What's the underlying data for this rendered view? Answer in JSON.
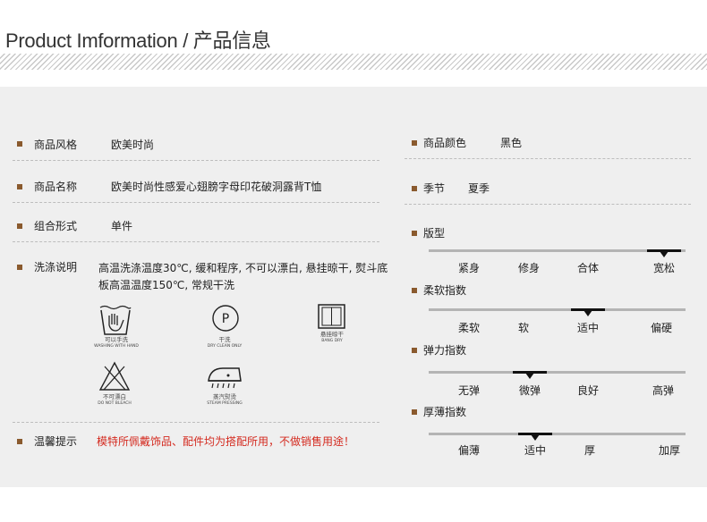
{
  "page": {
    "title": "Product Imformation / 产品信息"
  },
  "left": {
    "style": {
      "label": "商品风格",
      "value": "欧美时尚"
    },
    "name": {
      "label": "商品名称",
      "value": "欧美时尚性感爱心翅膀字母印花破洞露背T恤"
    },
    "combo": {
      "label": "组合形式",
      "value": "单件"
    },
    "washing": {
      "label": "洗涤说明",
      "text": "高温洗涤温度30℃, 缓和程序, 不可以漂白, 悬挂晾干, 熨斗底板高温温度150℃, 常规干洗",
      "icons": [
        {
          "name": "hand-wash-icon",
          "cn": "可以手洗",
          "en": "WASHING WITH HAND"
        },
        {
          "name": "dry-clean-icon",
          "cn": "干洗",
          "en": "DRY CLEAN ONLY",
          "letter": "P"
        },
        {
          "name": "hang-dry-icon",
          "cn": "悬挂晾干",
          "en": "BANG DRY"
        },
        {
          "name": "no-bleach-icon",
          "cn": "不可漂白",
          "en": "DO NOT BLEACH"
        },
        {
          "name": "steam-iron-icon",
          "cn": "蒸汽熨烫",
          "en": "STEAM PRESSING"
        }
      ]
    },
    "note": {
      "label": "温馨提示",
      "value": "模特所佩戴饰品、配件均为搭配所用，不做销售用途！",
      "color": "#d42a1f"
    }
  },
  "right": {
    "color": {
      "label": "商品颜色",
      "value": "黑色"
    },
    "season": {
      "label": "季节",
      "value": "夏季"
    },
    "scales": [
      {
        "label": "版型",
        "options": [
          "紧身",
          "修身",
          "合体",
          "宽松"
        ],
        "selected": 3
      },
      {
        "label": "柔软指数",
        "options": [
          "柔软",
          "软",
          "适中",
          "偏硬"
        ],
        "selected": 2
      },
      {
        "label": "弹力指数",
        "options": [
          "无弹",
          "微弹",
          "良好",
          "高弹"
        ],
        "selected": 1
      },
      {
        "label": "厚薄指数",
        "options": [
          "偏薄",
          "适中",
          "厚",
          "加厚"
        ],
        "selected": 1
      }
    ]
  },
  "colors": {
    "bullet": "#8a5a2e",
    "panel": "#efefef",
    "accent_text": "#d42a1f"
  }
}
